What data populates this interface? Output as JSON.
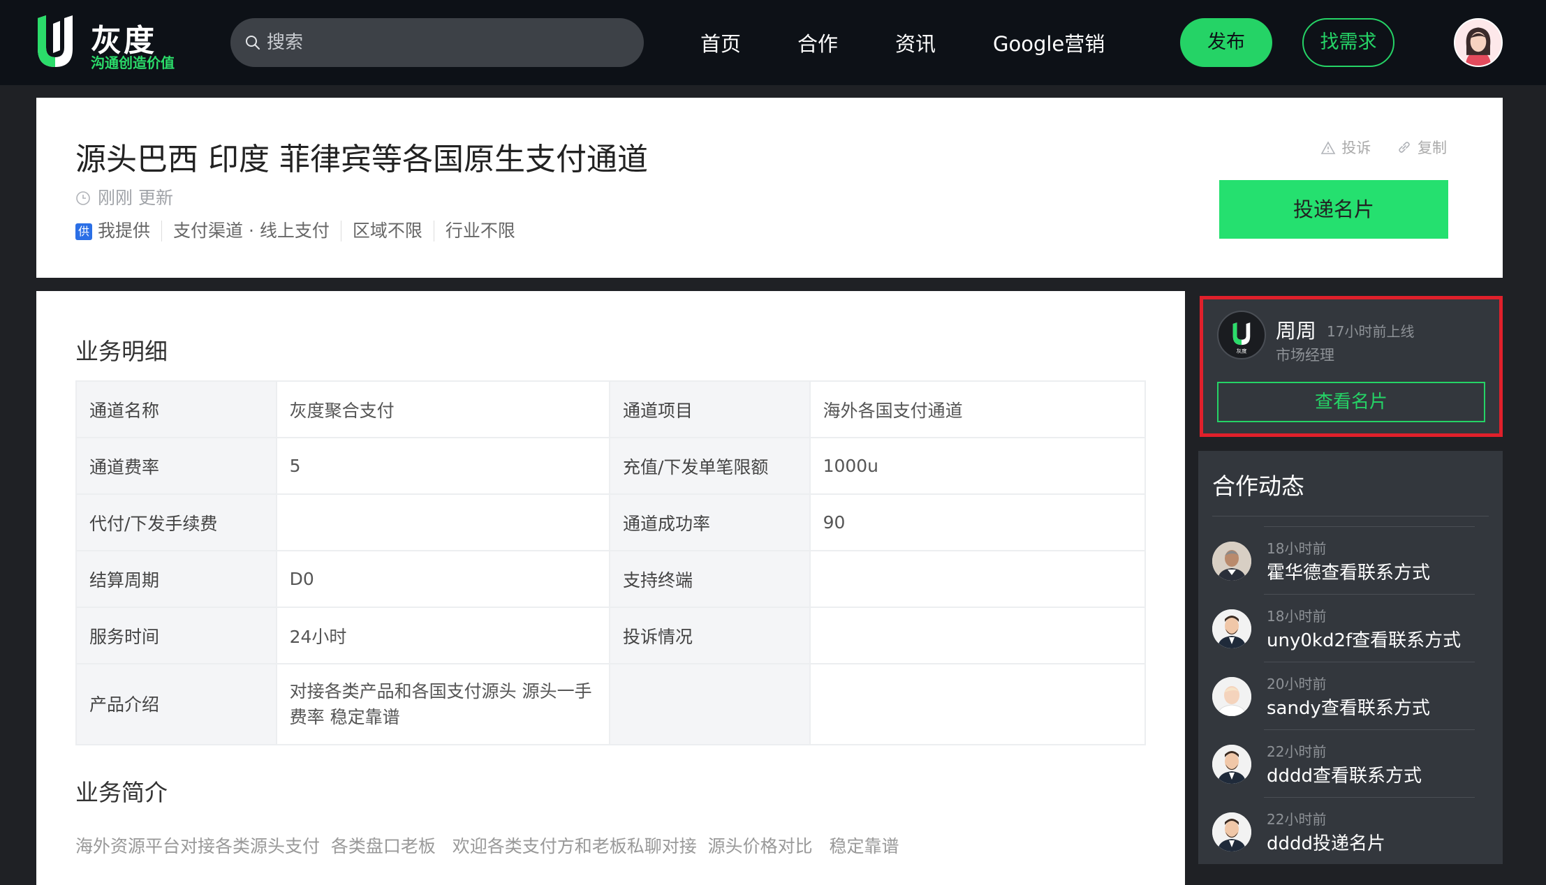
{
  "header": {
    "logo_name": "灰度",
    "logo_slogan": "沟通创造价值",
    "search_placeholder": "搜索",
    "nav": [
      "首页",
      "合作",
      "资讯",
      "Google营销"
    ],
    "publish_label": "发布",
    "demand_label": "找需求"
  },
  "listing": {
    "title": "源头巴西 印度 菲律宾等各国原生支付通道",
    "updated": "刚刚 更新",
    "provider_badge": "供",
    "tags": [
      "我提供",
      "支付渠道 · 线上支付",
      "区域不限",
      "行业不限"
    ],
    "complain_label": "投诉",
    "copy_label": "复制",
    "send_card_label": "投递名片"
  },
  "details": {
    "title": "业务明细",
    "rows": [
      [
        "通道名称",
        "灰度聚合支付",
        "通道项目",
        "海外各国支付通道"
      ],
      [
        "通道费率",
        "5",
        "充值/下发单笔限额",
        "1000u"
      ],
      [
        "代付/下发手续费",
        "",
        "通道成功率",
        "90"
      ],
      [
        "结算周期",
        "D0",
        "支持终端",
        ""
      ],
      [
        "服务时间",
        "24小时",
        "投诉情况",
        ""
      ],
      [
        "产品介绍",
        "对接各类产品和各国支付源头 源头一手费率 稳定靠谱",
        "",
        ""
      ]
    ]
  },
  "intro": {
    "title": "业务简介",
    "text": "海外资源平台对接各类源头支付  各类盘口老板   欢迎各类支付方和老板私聊对接  源头价格对比   稳定靠谱"
  },
  "contact": {
    "name": "周周",
    "online": "17小时前上线",
    "role": "市场经理",
    "view_card_label": "查看名片",
    "avatar_text": "灰度"
  },
  "feed": {
    "title": "合作动态",
    "items": [
      {
        "time": "18小时前",
        "text": "霍华德查看联系方式"
      },
      {
        "time": "18小时前",
        "text": "uny0kd2f查看联系方式"
      },
      {
        "time": "20小时前",
        "text": "sandy查看联系方式"
      },
      {
        "time": "22小时前",
        "text": "dddd查看联系方式"
      },
      {
        "time": "22小时前",
        "text": "dddd投递名片"
      }
    ]
  },
  "colors": {
    "brand_green": "#25d366",
    "header_bg": "#0d1117",
    "highlight_border": "#e0202b"
  }
}
